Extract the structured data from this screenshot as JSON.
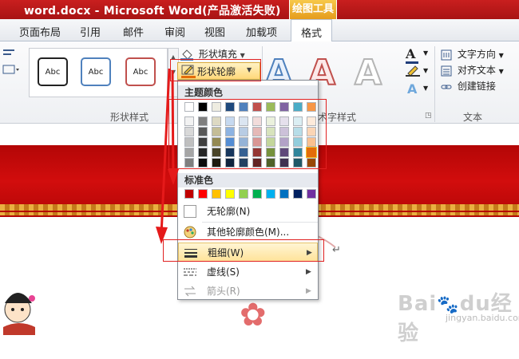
{
  "window": {
    "title": "word.docx - Microsoft Word(产品激活失败)",
    "context_tab": "绘图工具"
  },
  "tabs": [
    "页面布局",
    "引用",
    "邮件",
    "审阅",
    "视图",
    "加载项",
    "格式"
  ],
  "ribbon": {
    "shape_style_boxes": [
      "Abc",
      "Abc",
      "Abc"
    ],
    "shape_fill_label": "形状填充",
    "shape_outline_label": "形状轮廓",
    "group_shape_styles": "形状样式",
    "group_wordart_styles": "艺术字样式",
    "group_text": "文本",
    "wordart_letters": [
      "A",
      "A",
      "A"
    ],
    "wordart_small_a": "A",
    "text_direction_label": "文字方向",
    "align_text_label": "对齐文本",
    "create_link_label": "创建链接"
  },
  "dropdown": {
    "theme_colors_header": "主题颜色",
    "standard_colors_header": "标准色",
    "theme_top_row": [
      "#ffffff",
      "#000000",
      "#eeece1",
      "#1f497d",
      "#4f81bd",
      "#c0504d",
      "#9bbb59",
      "#8064a2",
      "#4bacc6",
      "#f79646"
    ],
    "theme_shades": [
      [
        "#f2f2f2",
        "#7f7f7f",
        "#ddd9c3",
        "#c6d9f0",
        "#dbe5f1",
        "#f2dcdb",
        "#ebf1dd",
        "#e5e0ec",
        "#dbeef3",
        "#fdeada"
      ],
      [
        "#d8d8d8",
        "#595959",
        "#c4bd97",
        "#8db3e2",
        "#b8cce4",
        "#e5b9b7",
        "#d7e3bc",
        "#ccc1d9",
        "#b7dde8",
        "#fbd5b5"
      ],
      [
        "#bfbfbf",
        "#3f3f3f",
        "#938953",
        "#548dd4",
        "#95b3d7",
        "#d99694",
        "#c3d69b",
        "#b2a2c7",
        "#92cddc",
        "#fac08f"
      ],
      [
        "#a5a5a5",
        "#262626",
        "#494429",
        "#17365d",
        "#366092",
        "#953734",
        "#76923c",
        "#5f497a",
        "#31859b",
        "#e36c09"
      ],
      [
        "#7f7f7f",
        "#0c0c0c",
        "#1d1b10",
        "#0f243e",
        "#244061",
        "#632423",
        "#4f6128",
        "#3f3151",
        "#205867",
        "#974806"
      ]
    ],
    "standard_colors": [
      "#c00000",
      "#ff0000",
      "#ffc000",
      "#ffff00",
      "#92d050",
      "#00b050",
      "#00b0f0",
      "#0070c0",
      "#002060",
      "#7030a0"
    ],
    "no_outline_label": "无轮廓(N)",
    "more_colors_label": "其他轮廓颜色(M)...",
    "weight_label": "粗细(W)",
    "dashes_label": "虚线(S)",
    "arrows_label": "箭头(R)"
  },
  "document": {
    "watermark": "Baidu经验",
    "watermark_sub": "jingyan.baidu.com",
    "paragraph_mark": "↵"
  },
  "colors": {
    "title_red": "#b81919",
    "context_orange": "#eba52a",
    "annotation_red": "#e02020"
  }
}
